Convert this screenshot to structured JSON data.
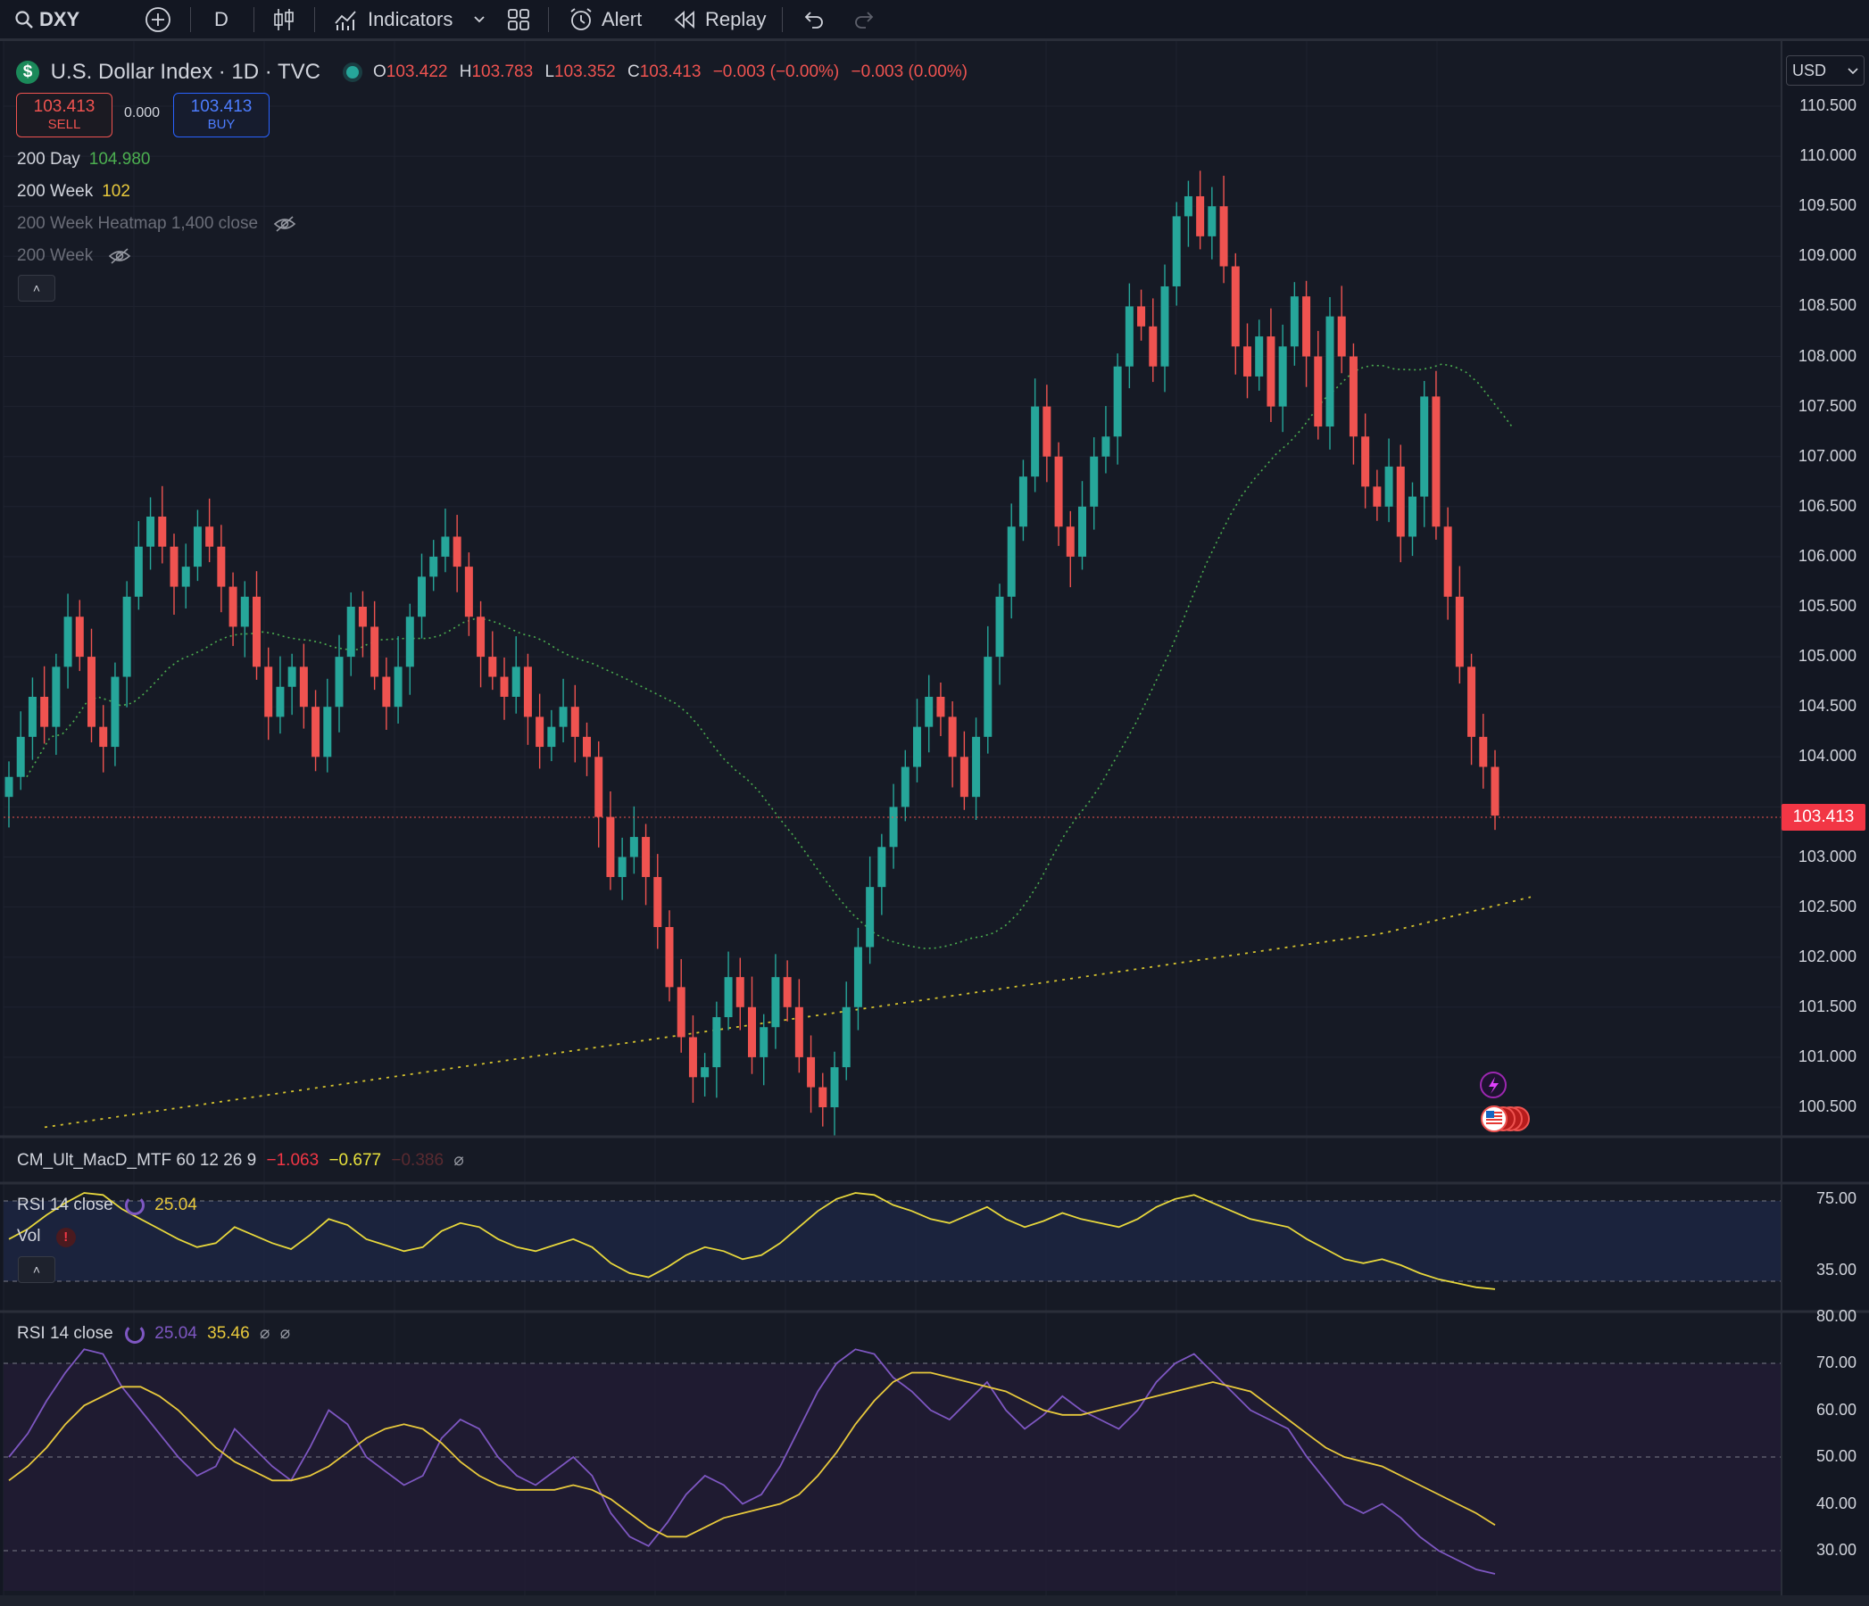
{
  "toolbar": {
    "symbol": "DXY",
    "interval": "D",
    "indicators_label": "Indicators",
    "alert_label": "Alert",
    "replay_label": "Replay"
  },
  "legend": {
    "title": "U.S. Dollar Index · 1D · TVC",
    "ohlc": {
      "o_label": "O",
      "o": "103.422",
      "h_label": "H",
      "h": "103.783",
      "l_label": "L",
      "l": "103.352",
      "c_label": "C",
      "c": "103.413",
      "change": "−0.003 (−0.00%)",
      "change2": "−0.003 (0.00%)"
    },
    "sell_price": "103.413",
    "sell_label": "SELL",
    "spread": "0.000",
    "buy_price": "103.413",
    "buy_label": "BUY",
    "indicators": [
      {
        "name": "200 Day",
        "value": "104.980"
      },
      {
        "name": "200 Week",
        "value": "102"
      },
      {
        "name": "200 Week Heatmap 1,400 close",
        "value": ""
      },
      {
        "name": "200 Week",
        "value": ""
      }
    ]
  },
  "currency": "USD",
  "price_axis": [
    "110.500",
    "110.000",
    "109.500",
    "109.000",
    "108.500",
    "108.000",
    "107.500",
    "107.000",
    "106.500",
    "106.000",
    "105.500",
    "105.000",
    "104.500",
    "104.000",
    "103.000",
    "102.500",
    "102.000",
    "101.500",
    "101.000",
    "100.500"
  ],
  "last_price_badge": "103.413",
  "macd_pane": {
    "label": "CM_Ult_MacD_MTF 60 12 26 9",
    "v1": "−1.063",
    "v2": "−0.677",
    "v3": "−0.386"
  },
  "rsi_pane1": {
    "label": "RSI 14 close",
    "value": "25.04",
    "vol_label": "Vol",
    "axis": [
      "75.00",
      "35.00"
    ]
  },
  "rsi_pane2": {
    "label": "RSI 14 close",
    "value": "25.04",
    "ma_value": "35.46",
    "axis": [
      "80.00",
      "70.00",
      "60.00",
      "50.00",
      "40.00",
      "30.00"
    ]
  },
  "colors": {
    "bg": "#131722",
    "up": "#26a69a",
    "down": "#ef5350",
    "ma200d": "#4caf50",
    "ma200w": "#d4c22e",
    "rsi": "#7e57c2",
    "rsi_ma": "#e8c93c",
    "accent": "#2962ff"
  },
  "chart_data": [
    {
      "type": "candlestick",
      "title": "U.S. Dollar Index · 1D · TVC",
      "ylim": [
        100.25,
        110.75
      ],
      "last": 103.413,
      "closes": [
        103.8,
        104.2,
        104.6,
        104.3,
        104.9,
        105.4,
        105.0,
        104.3,
        104.1,
        104.8,
        105.6,
        106.1,
        106.4,
        106.1,
        105.7,
        105.9,
        106.3,
        106.1,
        105.7,
        105.3,
        105.6,
        104.9,
        104.4,
        104.7,
        104.9,
        104.5,
        104.0,
        104.5,
        105.0,
        105.5,
        105.3,
        104.8,
        104.5,
        104.9,
        105.4,
        105.8,
        106.0,
        106.2,
        105.9,
        105.4,
        105.0,
        104.8,
        104.6,
        104.9,
        104.4,
        104.1,
        104.3,
        104.5,
        104.2,
        104.0,
        103.4,
        102.8,
        103.0,
        103.2,
        102.8,
        102.3,
        101.7,
        101.2,
        100.8,
        100.9,
        101.4,
        101.8,
        101.5,
        101.0,
        101.3,
        101.8,
        101.5,
        101.0,
        100.7,
        100.5,
        100.9,
        101.5,
        102.1,
        102.7,
        103.1,
        103.5,
        103.9,
        104.3,
        104.6,
        104.4,
        104.0,
        103.6,
        104.2,
        105.0,
        105.6,
        106.3,
        106.8,
        107.5,
        107.0,
        106.3,
        106.0,
        106.5,
        107.0,
        107.2,
        107.9,
        108.5,
        108.3,
        107.9,
        108.7,
        109.4,
        109.6,
        109.2,
        109.5,
        108.9,
        108.1,
        107.8,
        108.2,
        107.5,
        108.1,
        108.6,
        108.0,
        107.3,
        108.4,
        108.0,
        107.2,
        106.7,
        106.5,
        106.9,
        106.2,
        106.6,
        107.6,
        106.3,
        105.6,
        104.9,
        104.2,
        103.9,
        103.413
      ]
    },
    {
      "type": "line",
      "title": "RSI 14 close",
      "ylim": [
        25,
        80
      ],
      "series": [
        {
          "name": "RSI 14 close",
          "values": [
            50,
            55,
            62,
            68,
            73,
            72,
            65,
            60,
            55,
            50,
            46,
            48,
            56,
            52,
            48,
            45,
            52,
            60,
            57,
            50,
            47,
            44,
            46,
            54,
            58,
            56,
            50,
            46,
            44,
            47,
            50,
            46,
            38,
            33,
            31,
            36,
            42,
            46,
            44,
            40,
            42,
            48,
            56,
            64,
            70,
            73,
            72,
            67,
            64,
            60,
            58,
            62,
            66,
            60,
            56,
            59,
            63,
            60,
            58,
            56,
            60,
            66,
            70,
            72,
            68,
            64,
            60,
            58,
            56,
            50,
            45,
            40,
            38,
            40,
            37,
            33,
            30,
            28,
            26,
            25.04
          ]
        },
        {
          "name": "35.46",
          "values": [
            45,
            48,
            52,
            57,
            61,
            63,
            65,
            65,
            63,
            60,
            56,
            52,
            49,
            47,
            45,
            45,
            46,
            48,
            51,
            54,
            56,
            57,
            56,
            53,
            49,
            46,
            44,
            43,
            43,
            43,
            44,
            43,
            41,
            38,
            35,
            33,
            33,
            35,
            37,
            38,
            39,
            40,
            42,
            46,
            51,
            57,
            62,
            66,
            68,
            68,
            67,
            66,
            65,
            64,
            62,
            60,
            59,
            59,
            60,
            61,
            62,
            63,
            64,
            65,
            66,
            65,
            64,
            61,
            58,
            55,
            52,
            50,
            49,
            48,
            46,
            44,
            42,
            40,
            38,
            35.46
          ]
        }
      ]
    }
  ]
}
